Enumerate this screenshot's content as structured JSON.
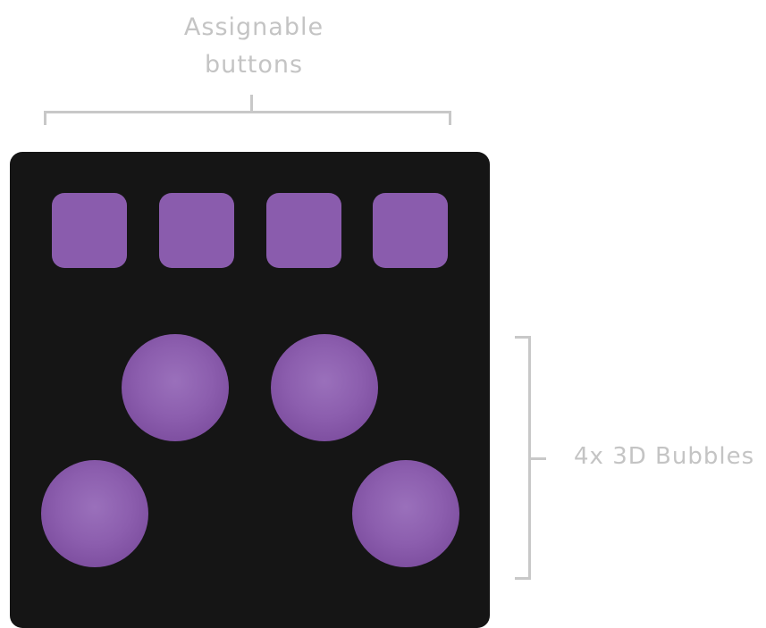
{
  "labels": {
    "top": "Assignable\nbuttons",
    "right": "4x 3D Bubbles"
  },
  "pads": [
    {
      "name": "assignable-button-1"
    },
    {
      "name": "assignable-button-2"
    },
    {
      "name": "assignable-button-3"
    },
    {
      "name": "assignable-button-4"
    }
  ],
  "bubbles": [
    {
      "name": "3d-bubble-top-left"
    },
    {
      "name": "3d-bubble-top-right"
    },
    {
      "name": "3d-bubble-bottom-left"
    },
    {
      "name": "3d-bubble-bottom-right"
    }
  ],
  "colors": {
    "device_body": "#151515",
    "accent_purple": "#8a5cad",
    "annotation_gray": "#c4c4c4",
    "background": "#ffffff"
  }
}
